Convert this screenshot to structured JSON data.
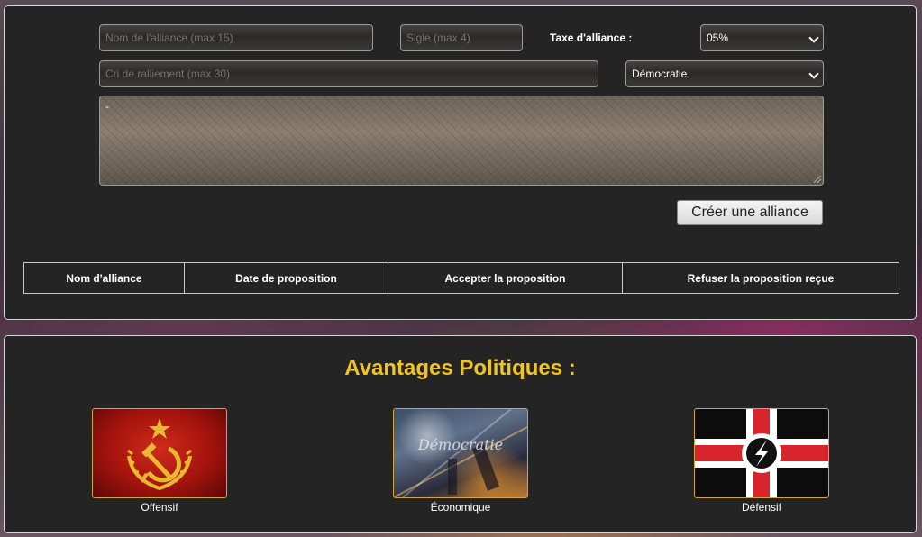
{
  "create_form": {
    "alliance_name_placeholder": "Nom de l'alliance (max 15)",
    "tag_placeholder": "Sigle (max 4)",
    "tax_label": "Taxe d'alliance :",
    "tax_selected": "05%",
    "rally_cry_placeholder": "Cri de ralliement (max 30)",
    "government_selected": "Démocratie",
    "description_value": "-",
    "create_button": "Créer une alliance"
  },
  "proposals_table": {
    "columns": [
      "Nom d'alliance",
      "Date de proposition",
      "Accepter la proposition",
      "Refuser la proposition reçue"
    ]
  },
  "advantages": {
    "title": "Avantages Politiques :",
    "cards": [
      {
        "label": "Offensif",
        "icon": "hammer-sickle-icon"
      },
      {
        "label": "Économique",
        "icon": "democratie-city-icon",
        "image_text": "Démocratie"
      },
      {
        "label": "Défensif",
        "icon": "cross-flag-icon"
      }
    ]
  },
  "colors": {
    "panel_bg": "#242424",
    "title_gold": "#f2c420",
    "card_border": "#d4a63a",
    "soviet_red": "#b8170f",
    "soviet_gold": "#e8b830",
    "flag_red": "#d8252b"
  }
}
